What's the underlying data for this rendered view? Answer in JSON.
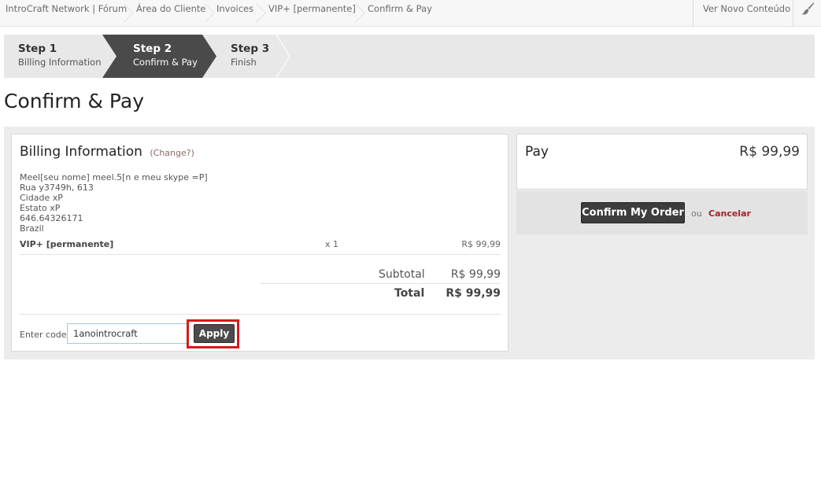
{
  "breadcrumb": {
    "items": [
      {
        "label": "IntroCraft Network | Fórum"
      },
      {
        "label": "Área do Cliente"
      },
      {
        "label": "Invoices"
      },
      {
        "label": "VIP+ [permanente]"
      },
      {
        "label": "Confirm & Pay"
      }
    ],
    "new_content_label": "Ver Novo Conteúdo",
    "style_icon": "paintbrush-icon"
  },
  "steps": [
    {
      "title": "Step 1",
      "subtitle": "Billing Information",
      "state": "completed"
    },
    {
      "title": "Step 2",
      "subtitle": "Confirm & Pay",
      "state": "active"
    },
    {
      "title": "Step 3",
      "subtitle": "Finish",
      "state": "upcoming"
    }
  ],
  "page_title": "Confirm & Pay",
  "billing": {
    "title": "Billing Information",
    "change_label": "(Change?)",
    "address_lines": [
      "Meel[seu nome] meel.5[n e meu skype =P]",
      "Rua y3749h, 613",
      "Cidade xP",
      "Estato xP",
      "646.64326171",
      "Brazil"
    ],
    "item": {
      "name": "VIP+ [permanente]",
      "qty": "x 1",
      "price": "R$ 99,99"
    },
    "subtotal_label": "Subtotal",
    "subtotal_value": "R$ 99,99",
    "total_label": "Total",
    "total_value": "R$ 99,99",
    "code_label": "Enter code:",
    "code_value": "1anointrocraft",
    "apply_label": "Apply"
  },
  "pay": {
    "label": "Pay",
    "amount": "R$ 99,99",
    "confirm_label": "Confirm My Order",
    "or_label": "ou",
    "cancel_label": "Cancelar"
  },
  "colors": {
    "active_step": "#4a4a4a",
    "highlight": "#d9191c",
    "cancel_link": "#a3232a"
  }
}
